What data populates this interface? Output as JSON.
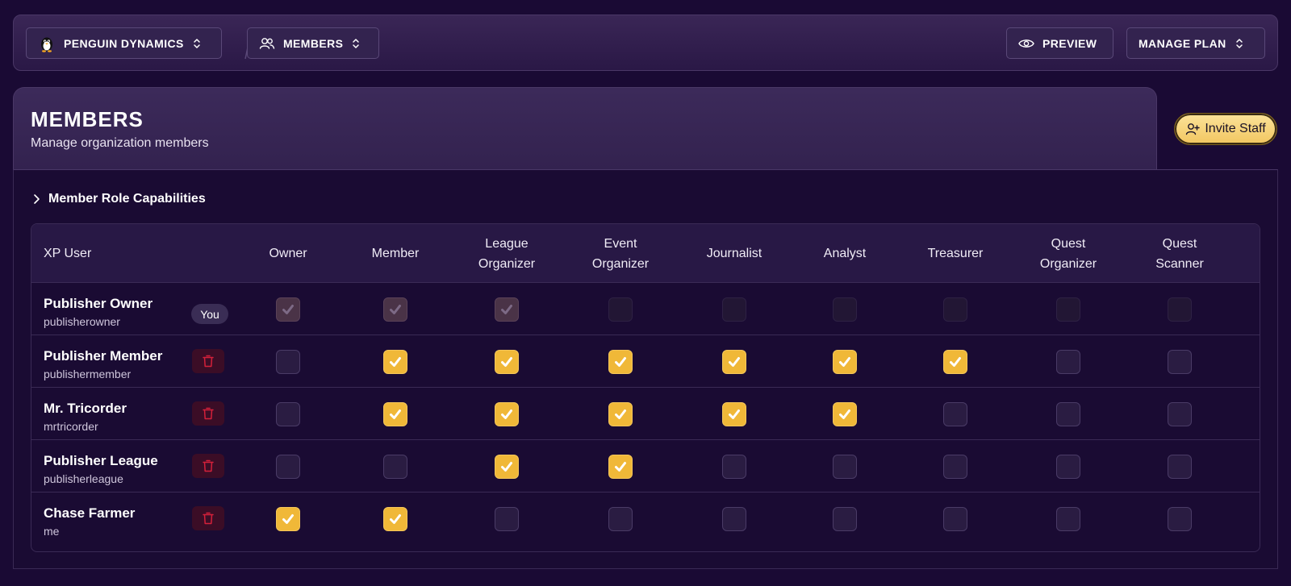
{
  "topbar": {
    "org_label": "PENGUIN DYNAMICS",
    "section_label": "MEMBERS",
    "preview_label": "PREVIEW",
    "manage_plan_label": "MANAGE PLAN"
  },
  "header": {
    "title": "MEMBERS",
    "subtitle": "Manage organization members"
  },
  "invite_label": "Invite Staff",
  "capabilities_label": "Member Role Capabilities",
  "table": {
    "user_header": "XP User",
    "you_badge": "You",
    "roles": [
      [
        "Owner"
      ],
      [
        "Member"
      ],
      [
        "League",
        "Organizer"
      ],
      [
        "Event",
        "Organizer"
      ],
      [
        "Journalist"
      ],
      [
        "Analyst"
      ],
      [
        "Treasurer"
      ],
      [
        "Quest",
        "Organizer"
      ],
      [
        "Quest",
        "Scanner"
      ]
    ],
    "members": [
      {
        "name": "Publisher Owner",
        "handle": "publisherowner",
        "is_you": true,
        "roles": [
          true,
          true,
          true,
          false,
          false,
          false,
          false,
          false,
          false
        ]
      },
      {
        "name": "Publisher Member",
        "handle": "publishermember",
        "is_you": false,
        "roles": [
          false,
          true,
          true,
          true,
          true,
          true,
          true,
          false,
          false
        ]
      },
      {
        "name": "Mr. Tricorder",
        "handle": "mrtricorder",
        "is_you": false,
        "roles": [
          false,
          true,
          true,
          true,
          true,
          true,
          false,
          false,
          false
        ]
      },
      {
        "name": "Publisher League",
        "handle": "publisherleague",
        "is_you": false,
        "roles": [
          false,
          false,
          true,
          true,
          false,
          false,
          false,
          false,
          false
        ]
      },
      {
        "name": "Chase Farmer",
        "handle": "me",
        "is_you": false,
        "roles": [
          true,
          true,
          false,
          false,
          false,
          false,
          false,
          false,
          false
        ]
      }
    ]
  },
  "colors": {
    "background": "#1a0a34",
    "accent_checked": "#f0b838",
    "invite_button": "#f5cd6a",
    "delete_icon": "#d4203a"
  }
}
